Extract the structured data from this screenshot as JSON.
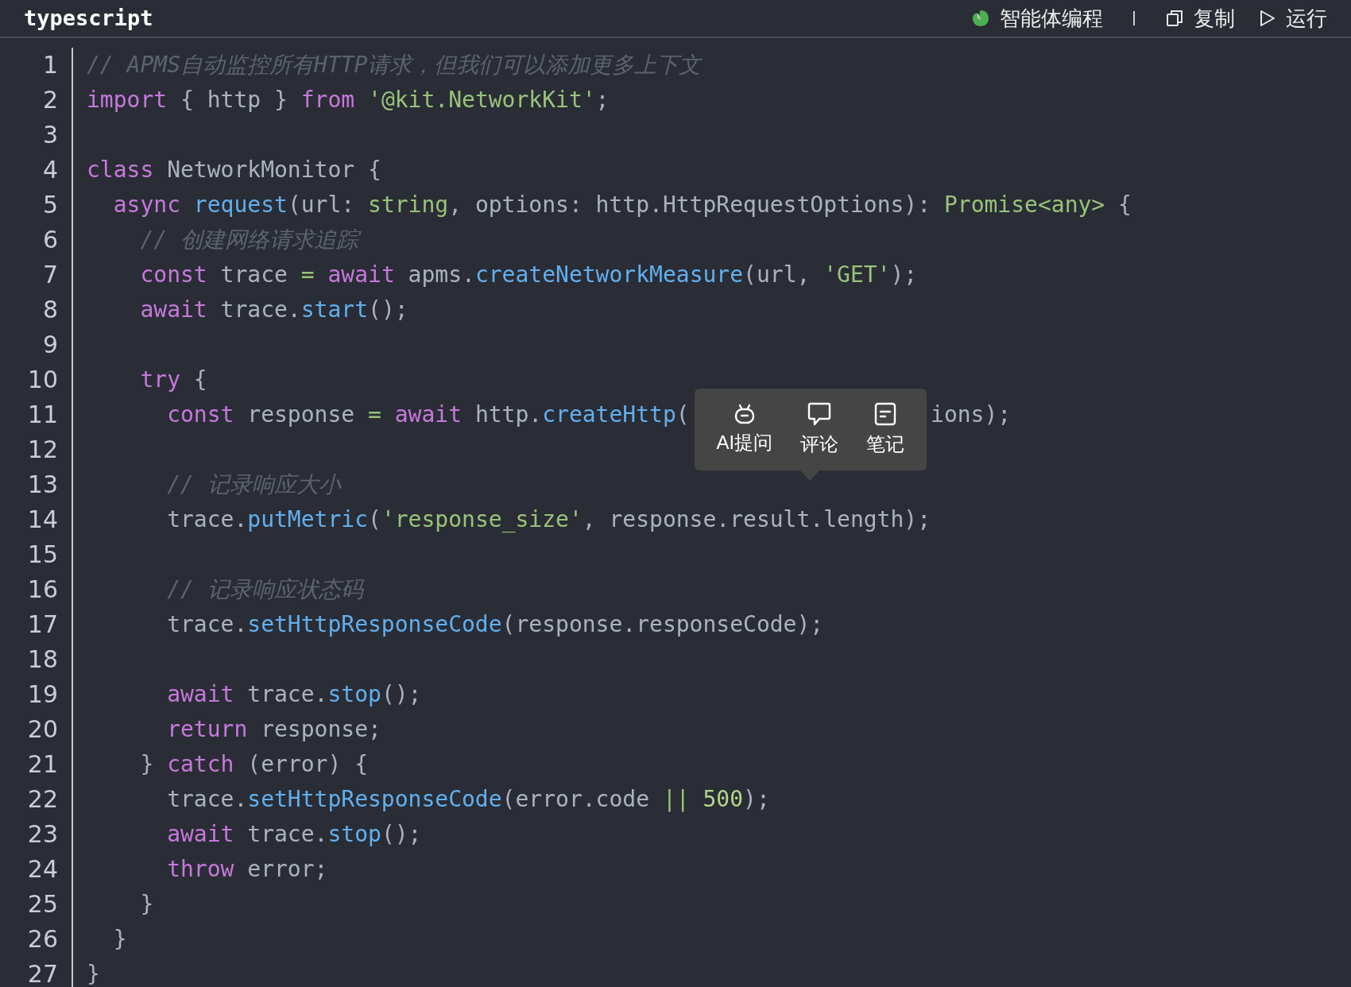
{
  "header": {
    "language": "typescript",
    "actions": [
      {
        "kind": "agent",
        "label": "智能体编程"
      },
      {
        "kind": "copy",
        "label": "复制"
      },
      {
        "kind": "run",
        "label": "运行"
      }
    ]
  },
  "lines": [
    {
      "number": "1",
      "tokens": [
        {
          "kind": "comment",
          "text": "// APMS自动监控所有HTTP请求，但我们可以添加更多上下文"
        }
      ]
    },
    {
      "number": "2",
      "tokens": [
        {
          "kind": "keyword",
          "text": "import"
        },
        {
          "kind": "plain",
          "text": " { http } "
        },
        {
          "kind": "keyword",
          "text": "from "
        },
        {
          "kind": "string",
          "text": "'@kit.NetworkKit'"
        },
        {
          "kind": "plain",
          "text": ";"
        }
      ]
    },
    {
      "number": "3"
    },
    {
      "number": "4",
      "tokens": [
        {
          "kind": "keyword",
          "text": "class"
        },
        {
          "kind": "plain",
          "text": " NetworkMonitor {"
        }
      ]
    },
    {
      "number": "5",
      "tokens": [
        {
          "kind": "keyword",
          "text": "  async "
        },
        {
          "kind": "function",
          "text": "request"
        },
        {
          "kind": "plain",
          "text": "(url: "
        },
        {
          "kind": "type",
          "text": "string"
        },
        {
          "kind": "plain",
          "text": ", options: http.HttpRequestOptions): "
        },
        {
          "kind": "type",
          "text": "Promise<any>"
        },
        {
          "kind": "plain",
          "text": " {"
        }
      ]
    },
    {
      "number": "6",
      "tokens": [
        {
          "kind": "comment",
          "text": "    // 创建网络请求追踪"
        }
      ]
    },
    {
      "number": "7",
      "tokens": [
        {
          "kind": "keyword",
          "text": "    const"
        },
        {
          "kind": "plain",
          "text": " trace "
        },
        {
          "kind": "operator",
          "text": "= "
        },
        {
          "kind": "keyword",
          "text": "await"
        },
        {
          "kind": "plain",
          "text": " apms."
        },
        {
          "kind": "function",
          "text": "createNetworkMeasure"
        },
        {
          "kind": "plain",
          "text": "(url, "
        },
        {
          "kind": "string",
          "text": "'GET'"
        },
        {
          "kind": "plain",
          "text": ");"
        }
      ]
    },
    {
      "number": "8",
      "tokens": [
        {
          "kind": "keyword",
          "text": "    await"
        },
        {
          "kind": "plain",
          "text": " trace."
        },
        {
          "kind": "function",
          "text": "start"
        },
        {
          "kind": "plain",
          "text": "();"
        }
      ]
    },
    {
      "number": "9"
    },
    {
      "number": "10",
      "tokens": [
        {
          "kind": "keyword",
          "text": "    try"
        },
        {
          "kind": "plain",
          "text": " {"
        }
      ]
    },
    {
      "number": "11",
      "tokens": [
        {
          "kind": "keyword",
          "text": "      const"
        },
        {
          "kind": "plain",
          "text": " response "
        },
        {
          "kind": "operator",
          "text": "= "
        },
        {
          "kind": "keyword",
          "text": "await"
        },
        {
          "kind": "plain",
          "text": " http."
        },
        {
          "kind": "function",
          "text": "createHttp"
        },
        {
          "kind": "plain",
          "text": "("
        },
        {
          "kind": "covered"
        },
        {
          "kind": "plain",
          "text": "ions);"
        }
      ]
    },
    {
      "number": "12"
    },
    {
      "number": "13",
      "tokens": [
        {
          "kind": "comment",
          "text": "      // 记录响应大小"
        }
      ]
    },
    {
      "number": "14",
      "tokens": [
        {
          "kind": "plain",
          "text": "      trace."
        },
        {
          "kind": "function",
          "text": "putMetric"
        },
        {
          "kind": "plain",
          "text": "("
        },
        {
          "kind": "string",
          "text": "'response_size'"
        },
        {
          "kind": "plain",
          "text": ", response.result.length);"
        }
      ]
    },
    {
      "number": "15"
    },
    {
      "number": "16",
      "tokens": [
        {
          "kind": "comment",
          "text": "      // 记录响应状态码"
        }
      ]
    },
    {
      "number": "17",
      "tokens": [
        {
          "kind": "plain",
          "text": "      trace."
        },
        {
          "kind": "function",
          "text": "setHttpResponseCode"
        },
        {
          "kind": "plain",
          "text": "(response.responseCode);"
        }
      ]
    },
    {
      "number": "18"
    },
    {
      "number": "19",
      "tokens": [
        {
          "kind": "keyword",
          "text": "      await"
        },
        {
          "kind": "plain",
          "text": " trace."
        },
        {
          "kind": "function",
          "text": "stop"
        },
        {
          "kind": "plain",
          "text": "();"
        }
      ]
    },
    {
      "number": "20",
      "tokens": [
        {
          "kind": "keyword",
          "text": "      return"
        },
        {
          "kind": "plain",
          "text": " response;"
        }
      ]
    },
    {
      "number": "21",
      "tokens": [
        {
          "kind": "plain",
          "text": "    } "
        },
        {
          "kind": "keyword",
          "text": "catch"
        },
        {
          "kind": "plain",
          "text": " (error) {"
        }
      ]
    },
    {
      "number": "22",
      "tokens": [
        {
          "kind": "plain",
          "text": "      trace."
        },
        {
          "kind": "function",
          "text": "setHttpResponseCode"
        },
        {
          "kind": "plain",
          "text": "(error.code "
        },
        {
          "kind": "operator",
          "text": "|| "
        },
        {
          "kind": "number",
          "text": "500"
        },
        {
          "kind": "plain",
          "text": ");"
        }
      ]
    },
    {
      "number": "23",
      "tokens": [
        {
          "kind": "keyword",
          "text": "      await"
        },
        {
          "kind": "plain",
          "text": " trace."
        },
        {
          "kind": "function",
          "text": "stop"
        },
        {
          "kind": "plain",
          "text": "();"
        }
      ]
    },
    {
      "number": "24",
      "tokens": [
        {
          "kind": "keyword",
          "text": "      throw"
        },
        {
          "kind": "plain",
          "text": " error;"
        }
      ]
    },
    {
      "number": "25",
      "tokens": [
        {
          "kind": "plain",
          "text": "    }"
        }
      ]
    },
    {
      "number": "26",
      "tokens": [
        {
          "kind": "plain",
          "text": "  }"
        }
      ]
    },
    {
      "number": "27",
      "tokens": [
        {
          "kind": "plain",
          "text": "}"
        }
      ]
    }
  ],
  "popup": {
    "items": [
      {
        "kind": "ai",
        "label": "AI提问"
      },
      {
        "kind": "comment",
        "label": "评论"
      },
      {
        "kind": "note",
        "label": "笔记"
      }
    ]
  }
}
